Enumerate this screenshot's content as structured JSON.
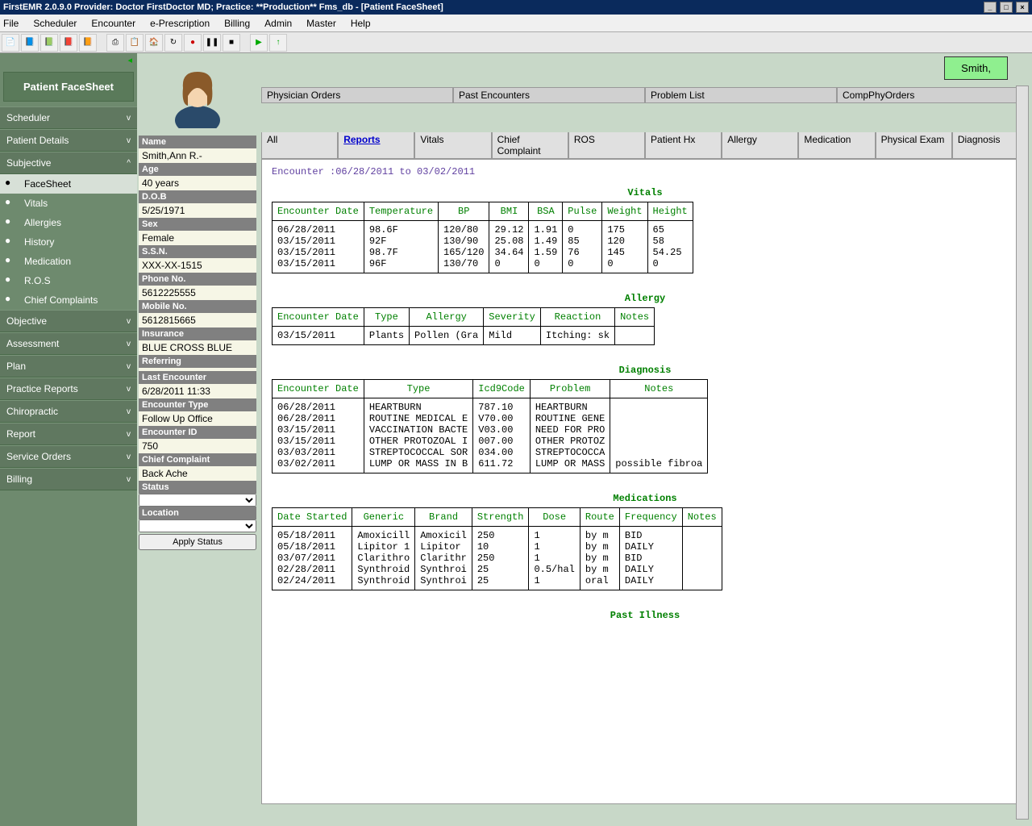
{
  "window": {
    "title": "FirstEMR 2.0.9.0 Provider: Doctor FirstDoctor MD; Practice: **Production** Fms_db - [Patient FaceSheet]"
  },
  "menubar": [
    "File",
    "Scheduler",
    "Encounter",
    "e-Prescription",
    "Billing",
    "Admin",
    "Master",
    "Help"
  ],
  "sidebar": {
    "header": "Patient FaceSheet",
    "items": [
      {
        "label": "Scheduler",
        "type": "btn",
        "chev": "v"
      },
      {
        "label": "Patient Details",
        "type": "btn",
        "chev": "v"
      },
      {
        "label": "Subjective",
        "type": "btn",
        "chev": "^"
      },
      {
        "label": "FaceSheet",
        "type": "sub",
        "active": true
      },
      {
        "label": "Vitals",
        "type": "sub"
      },
      {
        "label": "Allergies",
        "type": "sub"
      },
      {
        "label": "History",
        "type": "sub"
      },
      {
        "label": "Medication",
        "type": "sub"
      },
      {
        "label": "R.O.S",
        "type": "sub"
      },
      {
        "label": "Chief Complaints",
        "type": "sub"
      },
      {
        "label": "Objective",
        "type": "btn",
        "chev": "v"
      },
      {
        "label": "Assessment",
        "type": "btn",
        "chev": "v"
      },
      {
        "label": "Plan",
        "type": "btn",
        "chev": "v"
      },
      {
        "label": "Practice Reports",
        "type": "btn",
        "chev": "v"
      },
      {
        "label": "Chiropractic",
        "type": "btn",
        "chev": "v"
      },
      {
        "label": "Report",
        "type": "btn",
        "chev": "v"
      },
      {
        "label": "Service Orders",
        "type": "btn",
        "chev": "v"
      },
      {
        "label": "Billing",
        "type": "btn",
        "chev": "v"
      }
    ]
  },
  "patient": {
    "fields": [
      {
        "label": "Name",
        "value": "Smith,Ann R.-"
      },
      {
        "label": "Age",
        "value": "40 years"
      },
      {
        "label": "D.O.B",
        "value": "5/25/1971"
      },
      {
        "label": "Sex",
        "value": "Female"
      },
      {
        "label": "S.S.N.",
        "value": "XXX-XX-1515"
      },
      {
        "label": "Phone No.",
        "value": "5612225555"
      },
      {
        "label": "Mobile No.",
        "value": "5612815665"
      },
      {
        "label": "Insurance",
        "value": "BLUE CROSS BLUE"
      },
      {
        "label": "Referring",
        "value": ""
      },
      {
        "label": "Last Encounter",
        "value": "6/28/2011 11:33"
      },
      {
        "label": "Encounter Type",
        "value": "Follow Up Office"
      },
      {
        "label": "Encounter ID",
        "value": "750"
      },
      {
        "label": "Chief Complaint",
        "value": "Back Ache"
      }
    ],
    "status_label": "Status",
    "location_label": "Location",
    "apply_status": "Apply Status"
  },
  "badge": "Smith,",
  "tabs_top": [
    "Physician Orders",
    "Past Encounters",
    "Problem List",
    "CompPhyOrders"
  ],
  "tabs_sub": [
    "All",
    "Reports",
    "Vitals",
    "Chief Complaint",
    "ROS",
    "Patient Hx",
    "Allergy",
    "Medication",
    "Physical Exam",
    "Diagnosis"
  ],
  "report": {
    "encounter_range": "Encounter :06/28/2011 to 03/02/2011",
    "sections": {
      "vitals": {
        "title": "Vitals",
        "headers": [
          "Encounter Date",
          "Temperature",
          "BP",
          "BMI",
          "BSA",
          "Pulse",
          "Weight",
          "Height"
        ],
        "rows": [
          [
            "06/28/2011",
            "98.6F",
            "120/80",
            "29.12",
            "1.91",
            "0",
            "175",
            "65"
          ],
          [
            "03/15/2011",
            "92F",
            "130/90",
            "25.08",
            "1.49",
            "85",
            "120",
            "58"
          ],
          [
            "03/15/2011",
            "98.7F",
            "165/120",
            "34.64",
            "1.59",
            "76",
            "145",
            "54.25"
          ],
          [
            "03/15/2011",
            "96F",
            "130/70",
            "0",
            "0",
            "0",
            "0",
            "0"
          ]
        ]
      },
      "allergy": {
        "title": "Allergy",
        "headers": [
          "Encounter Date",
          "Type",
          "Allergy",
          "Severity",
          "Reaction",
          "Notes"
        ],
        "rows": [
          [
            "03/15/2011",
            "Plants",
            "Pollen (Gra",
            "Mild",
            "Itching: sk",
            ""
          ]
        ]
      },
      "diagnosis": {
        "title": "Diagnosis",
        "headers": [
          "Encounter Date",
          "Type",
          "Icd9Code",
          "Problem",
          "Notes"
        ],
        "rows": [
          [
            "06/28/2011",
            "HEARTBURN",
            "787.10",
            "HEARTBURN",
            ""
          ],
          [
            "06/28/2011",
            "ROUTINE MEDICAL E",
            "V70.00",
            "ROUTINE GENE",
            ""
          ],
          [
            "03/15/2011",
            "VACCINATION BACTE",
            "V03.00",
            "NEED FOR PRO",
            ""
          ],
          [
            "03/15/2011",
            "OTHER PROTOZOAL I",
            "007.00",
            "OTHER PROTOZ",
            ""
          ],
          [
            "03/03/2011",
            "STREPTOCOCCAL SOR",
            "034.00",
            "STREPTOCOCCA",
            ""
          ],
          [
            "03/02/2011",
            "LUMP OR MASS IN B",
            "611.72",
            "LUMP OR MASS",
            "possible fibroa"
          ]
        ]
      },
      "medications": {
        "title": "Medications",
        "headers": [
          "Date Started",
          "Generic",
          "Brand",
          "Strength",
          "Dose",
          "Route",
          "Frequency",
          "Notes"
        ],
        "rows": [
          [
            "05/18/2011",
            "Amoxicill",
            "Amoxicil",
            "250",
            "1",
            "by m",
            "BID",
            ""
          ],
          [
            "05/18/2011",
            "Lipitor 1",
            "Lipitor",
            "10",
            "1",
            "by m",
            "DAILY",
            ""
          ],
          [
            "03/07/2011",
            "Clarithro",
            "Clarithr",
            "250",
            "1",
            "by m",
            "BID",
            ""
          ],
          [
            "02/28/2011",
            "Synthroid",
            "Synthroi",
            "25",
            "0.5/hal",
            "by m",
            "DAILY",
            ""
          ],
          [
            "02/24/2011",
            "Synthroid",
            "Synthroi",
            "25",
            "1",
            "oral",
            "DAILY",
            ""
          ]
        ]
      },
      "past_illness": {
        "title": "Past Illness"
      }
    }
  }
}
